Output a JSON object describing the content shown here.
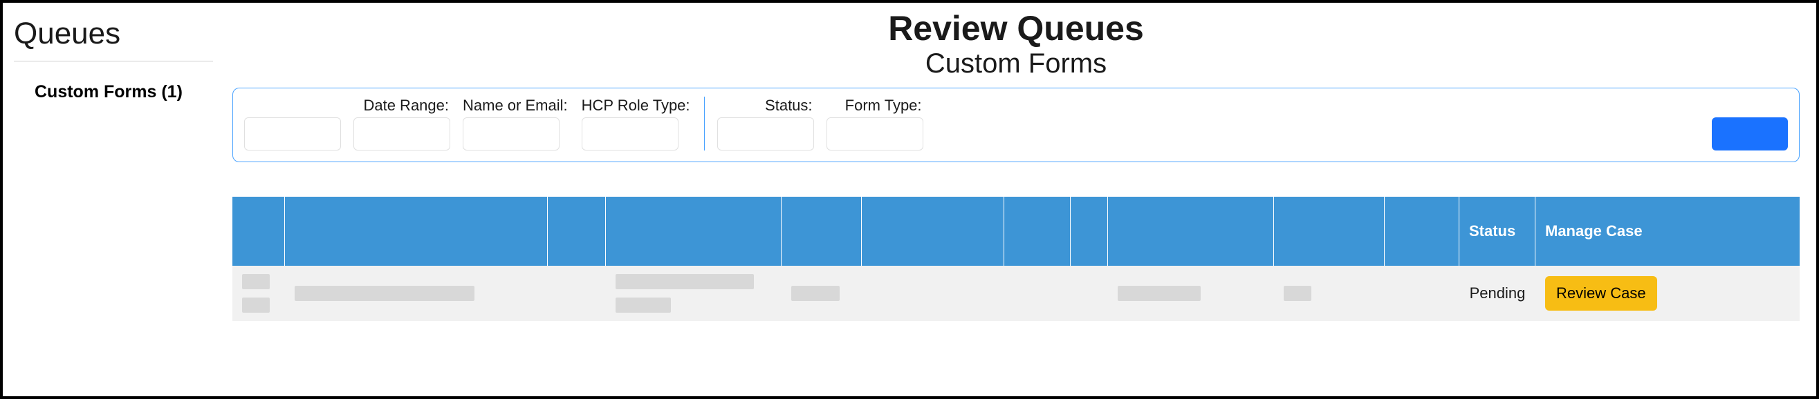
{
  "sidebar": {
    "title": "Queues",
    "items": [
      {
        "label": "Custom Forms (1)"
      }
    ]
  },
  "main": {
    "title": "Review Queues",
    "subtitle": "Custom Forms"
  },
  "filters": {
    "date_range_label": "Date Range:",
    "name_email_label": "Name or Email:",
    "hcp_role_label": "HCP Role Type:",
    "status_label": "Status:",
    "form_type_label": "Form Type:",
    "date_from": "",
    "date_to": "",
    "name_email": "",
    "hcp_role": "",
    "status": "",
    "form_type": ""
  },
  "table": {
    "headers": {
      "status": "Status",
      "manage": "Manage Case"
    },
    "rows": [
      {
        "status": "Pending",
        "action_label": "Review Case"
      }
    ]
  }
}
